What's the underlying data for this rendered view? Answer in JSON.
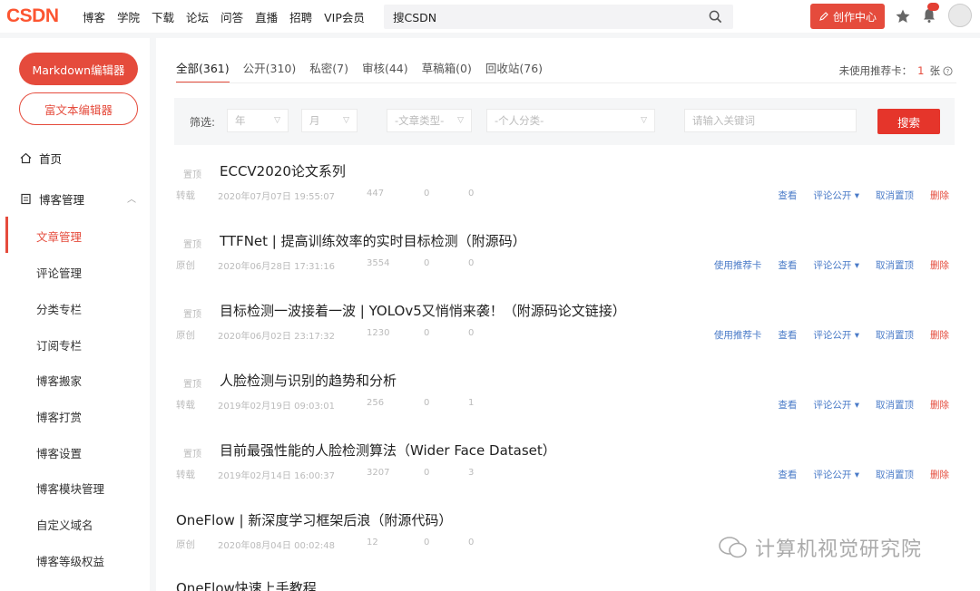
{
  "nav": {
    "logo": "CSDN",
    "links": [
      "博客",
      "学院",
      "下载",
      "论坛",
      "问答",
      "直播",
      "招聘",
      "VIP会员"
    ],
    "search_value": "搜CSDN",
    "create_label": "创作中心"
  },
  "sidebar": {
    "markdown_btn": "Markdown编辑器",
    "richtext_btn": "富文本编辑器",
    "home": "首页",
    "manage": "博客管理",
    "items": [
      "文章管理",
      "评论管理",
      "分类专栏",
      "订阅专栏",
      "博客搬家",
      "博客打赏",
      "博客设置",
      "博客模块管理",
      "自定义域名",
      "博客等级权益"
    ]
  },
  "tabs": [
    "全部(361)",
    "公开(310)",
    "私密(7)",
    "审核(44)",
    "草稿箱(0)",
    "回收站(76)"
  ],
  "unused_card": {
    "label": "未使用推荐卡：",
    "count": "1",
    "unit": "张"
  },
  "filter": {
    "label": "筛选:",
    "year": "年",
    "month": "月",
    "type": "-文章类型-",
    "category": "-个人分类-",
    "keyword_placeholder": "请输入关键词",
    "search_btn": "搜索"
  },
  "articles": [
    {
      "tag": "置顶",
      "title": "ECCV2020论文系列",
      "type": "转载",
      "date": "2020年07月07日 19:55:07",
      "views": "447",
      "comments": "0",
      "likes": "0",
      "actions": [
        "查看",
        "评论公开 ▾",
        "取消置顶",
        "删除"
      ]
    },
    {
      "tag": "置顶",
      "title": "TTFNet | 提高训练效率的实时目标检测（附源码）",
      "type": "原创",
      "date": "2020年06月28日 17:31:16",
      "views": "3554",
      "comments": "0",
      "likes": "0",
      "actions": [
        "使用推荐卡",
        "查看",
        "评论公开 ▾",
        "取消置顶",
        "删除"
      ]
    },
    {
      "tag": "置顶",
      "title": "目标检测一波接着一波 | YOLOv5又悄悄来袭！（附源码论文链接）",
      "type": "原创",
      "date": "2020年06月02日 23:17:32",
      "views": "1230",
      "comments": "0",
      "likes": "0",
      "actions": [
        "使用推荐卡",
        "查看",
        "评论公开 ▾",
        "取消置顶",
        "删除"
      ]
    },
    {
      "tag": "置顶",
      "title": "人脸检测与识别的趋势和分析",
      "type": "转载",
      "date": "2019年02月19日 09:03:01",
      "views": "256",
      "comments": "0",
      "likes": "1",
      "actions": [
        "查看",
        "评论公开 ▾",
        "取消置顶",
        "删除"
      ]
    },
    {
      "tag": "置顶",
      "title": "目前最强性能的人脸检测算法（Wider Face Dataset）",
      "type": "转载",
      "date": "2019年02月14日 16:00:37",
      "views": "3207",
      "comments": "0",
      "likes": "3",
      "actions": [
        "查看",
        "评论公开 ▾",
        "取消置顶",
        "删除"
      ]
    },
    {
      "tag": "",
      "title": "OneFlow | 新深度学习框架后浪（附源代码）",
      "type": "原创",
      "date": "2020年08月04日 00:02:48",
      "views": "12",
      "comments": "0",
      "likes": "0",
      "actions": []
    },
    {
      "tag": "",
      "title": "OneFlow快速上手教程",
      "type": "",
      "date": "",
      "views": "",
      "comments": "",
      "likes": "",
      "actions": []
    }
  ],
  "watermark": "计算机视觉研究院"
}
